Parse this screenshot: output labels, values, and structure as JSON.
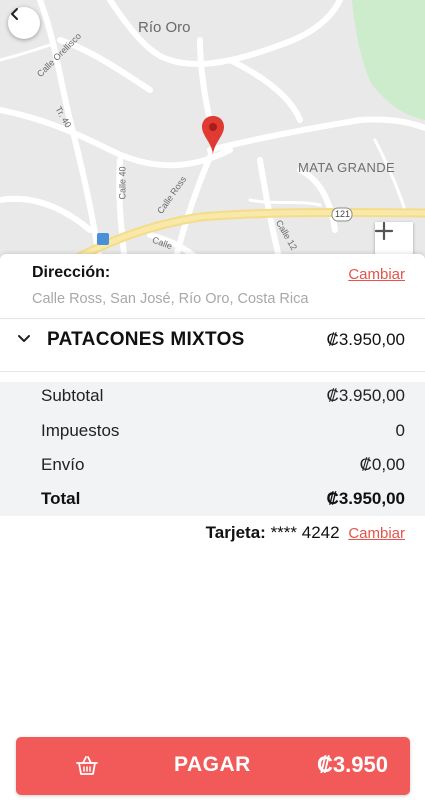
{
  "map": {
    "labels": {
      "town": "Río Oro",
      "district": "MATA GRANDE",
      "street1": "Calle Orellisco",
      "street2": "Tr. 40",
      "street3": "Calle 40",
      "street4": "Calle Ross",
      "street5": "Calle",
      "street6": "Calle 12",
      "route": "121"
    },
    "icons": {
      "back": "back-arrow-icon",
      "zoom": "plus-icon",
      "pin": "map-pin-icon",
      "bus": "bus-stop-icon"
    }
  },
  "address": {
    "title": "Dirección:",
    "change_label": "Cambiar",
    "value": "Calle Ross, San José, Río Oro, Costa Rica"
  },
  "order": {
    "item_name": "PATACONES MIXTOS",
    "item_price": "₡3.950,00"
  },
  "summary": {
    "subtotal_label": "Subtotal",
    "subtotal_value": "₡3.950,00",
    "tax_label": "Impuestos",
    "tax_value": "0",
    "shipping_label": "Envío",
    "shipping_value": "₡0,00",
    "total_label": "Total",
    "total_value": "₡3.950,00"
  },
  "payment": {
    "card_label": "Tarjeta:",
    "card_value": "**** 4242",
    "change_label": "Cambiar"
  },
  "pay_button": {
    "label": "PAGAR",
    "amount": "₡3.950",
    "icon": "basket-icon"
  },
  "colors": {
    "accent": "#f25a5a",
    "link": "#e5534b",
    "summary_bg": "#f2f3f4"
  }
}
